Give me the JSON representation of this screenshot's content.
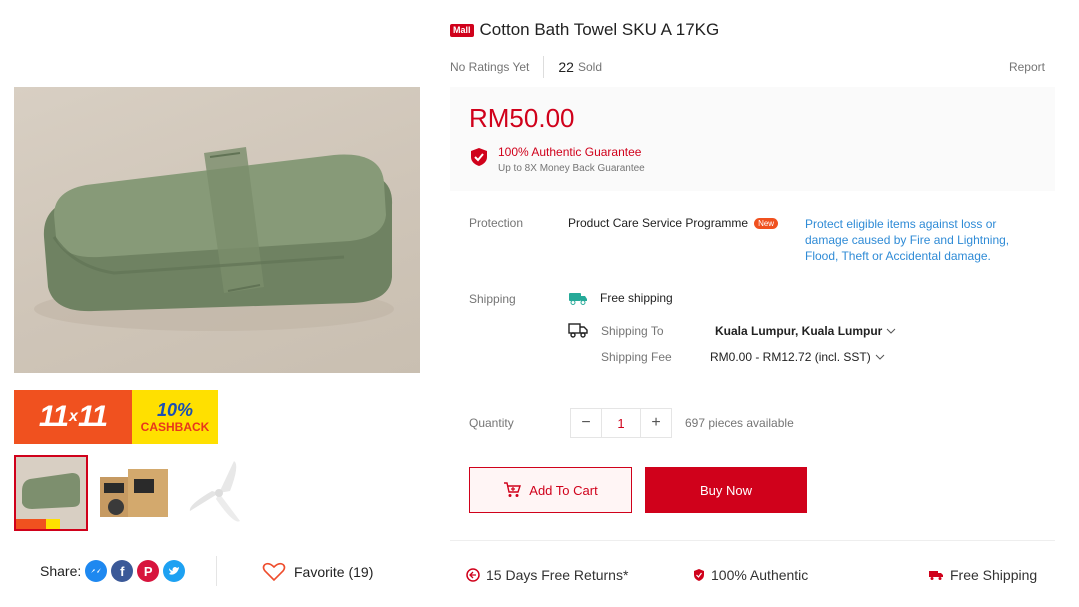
{
  "product": {
    "mall_badge": "Mall",
    "title": "Cotton Bath Towel SKU A 17KG",
    "ratings": "No Ratings Yet",
    "sold_count": "22",
    "sold_label": "Sold",
    "report": "Report",
    "price": "RM50.00"
  },
  "guarantee": {
    "title": "100% Authentic Guarantee",
    "subtitle": "Up to 8X Money Back Guarantee"
  },
  "protection": {
    "label": "Protection",
    "name": "Product Care Service Programme",
    "badge": "New",
    "description": "Protect eligible items against loss or damage caused by Fire and Lightning, Flood, Theft or Accidental damage."
  },
  "shipping": {
    "label": "Shipping",
    "free_shipping": "Free shipping",
    "to_label": "Shipping To",
    "to_value": "Kuala Lumpur, Kuala Lumpur",
    "fee_label": "Shipping Fee",
    "fee_value": "RM0.00 - RM12.72 (incl. SST)"
  },
  "quantity": {
    "label": "Quantity",
    "minus": "−",
    "value": "1",
    "plus": "+",
    "available": "697 pieces available"
  },
  "actions": {
    "add_to_cart": "Add To Cart",
    "buy_now": "Buy Now"
  },
  "promo": {
    "event": "11.11",
    "event_left": "11",
    "event_x": "x",
    "event_right": "11",
    "cashback_pct": "10%",
    "cashback_label": "CASHBACK"
  },
  "social": {
    "share_label": "Share:",
    "favorite_label": "Favorite (19)"
  },
  "features": {
    "returns": "15 Days Free Returns*",
    "authentic": "100% Authentic",
    "free_shipping": "Free Shipping"
  },
  "colors": {
    "brand_red": "#d0011b",
    "link_blue": "#2f8bd6",
    "promo_orange": "#f0511f",
    "promo_yellow": "#ffe000",
    "towel_green": "#7d8f6e"
  }
}
